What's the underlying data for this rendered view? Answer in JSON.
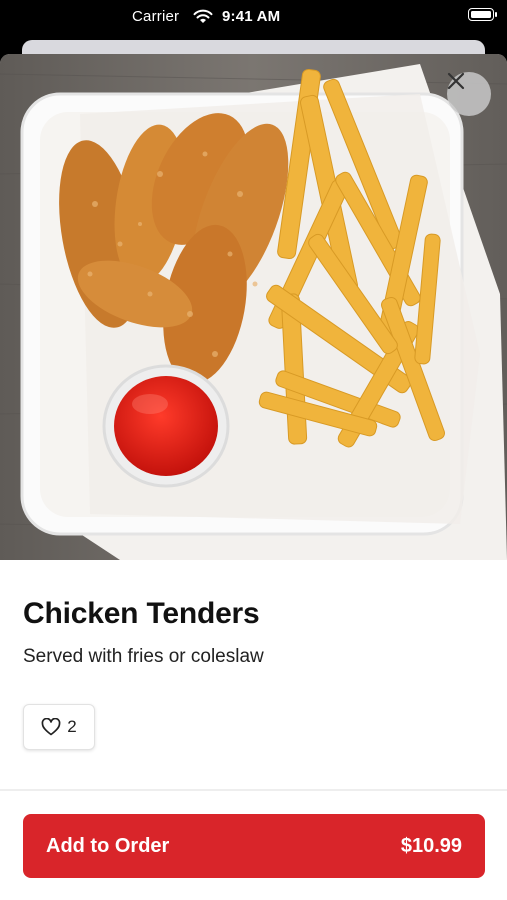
{
  "status_bar": {
    "carrier": "Carrier",
    "time": "9:41 AM"
  },
  "item": {
    "image_icon": "chicken-tenders-with-fries-photo",
    "title": "Chicken Tenders",
    "description": "Served with fries or coleslaw",
    "likes": "2"
  },
  "order": {
    "label": "Add to Order",
    "price": "$10.99"
  },
  "colors": {
    "accent": "#d9252a"
  }
}
